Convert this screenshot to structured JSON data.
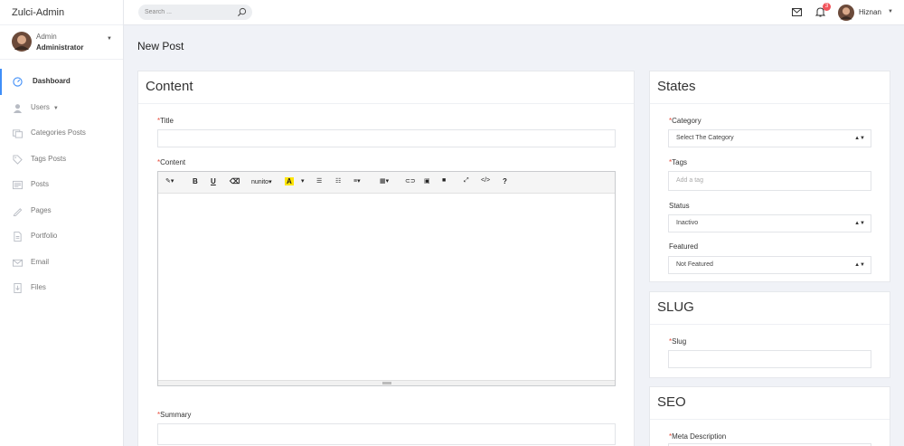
{
  "brand": "Zulci-Admin",
  "sidebar": {
    "user": {
      "name": "Admin",
      "role": "Administrator"
    },
    "items": [
      {
        "label": "Dashboard",
        "icon": "dashboard-icon",
        "active": true
      },
      {
        "label": "Users",
        "icon": "user-icon",
        "has_submenu": true
      },
      {
        "label": "Categories Posts",
        "icon": "categories-icon"
      },
      {
        "label": "Tags Posts",
        "icon": "tag-icon"
      },
      {
        "label": "Posts",
        "icon": "posts-icon"
      },
      {
        "label": "Pages",
        "icon": "pencil-icon"
      },
      {
        "label": "Portfolio",
        "icon": "document-icon"
      },
      {
        "label": "Email",
        "icon": "mail-icon"
      },
      {
        "label": "Files",
        "icon": "file-icon"
      }
    ]
  },
  "topbar": {
    "search_placeholder": "Search ...",
    "notification_count": "3",
    "user_name": "Hiznan"
  },
  "page_title": "New Post",
  "content_card": {
    "title": "Content",
    "title_label": "Title",
    "content_label": "Content",
    "summary_label": "Summary",
    "font_name": "nunito"
  },
  "states_card": {
    "title": "States",
    "category_label": "Category",
    "category_value": "Select The Category",
    "tags_label": "Tags",
    "tags_placeholder": "Add a tag",
    "status_label": "Status",
    "status_value": "Inactivo",
    "featured_label": "Featured",
    "featured_value": "Not Featured"
  },
  "slug_card": {
    "title": "SLUG",
    "slug_label": "Slug"
  },
  "seo_card": {
    "title": "SEO",
    "meta_label": "Meta Description"
  },
  "colors": {
    "accent": "#3f8ef8",
    "badge": "#f2545b",
    "required": "#e74c3c"
  }
}
